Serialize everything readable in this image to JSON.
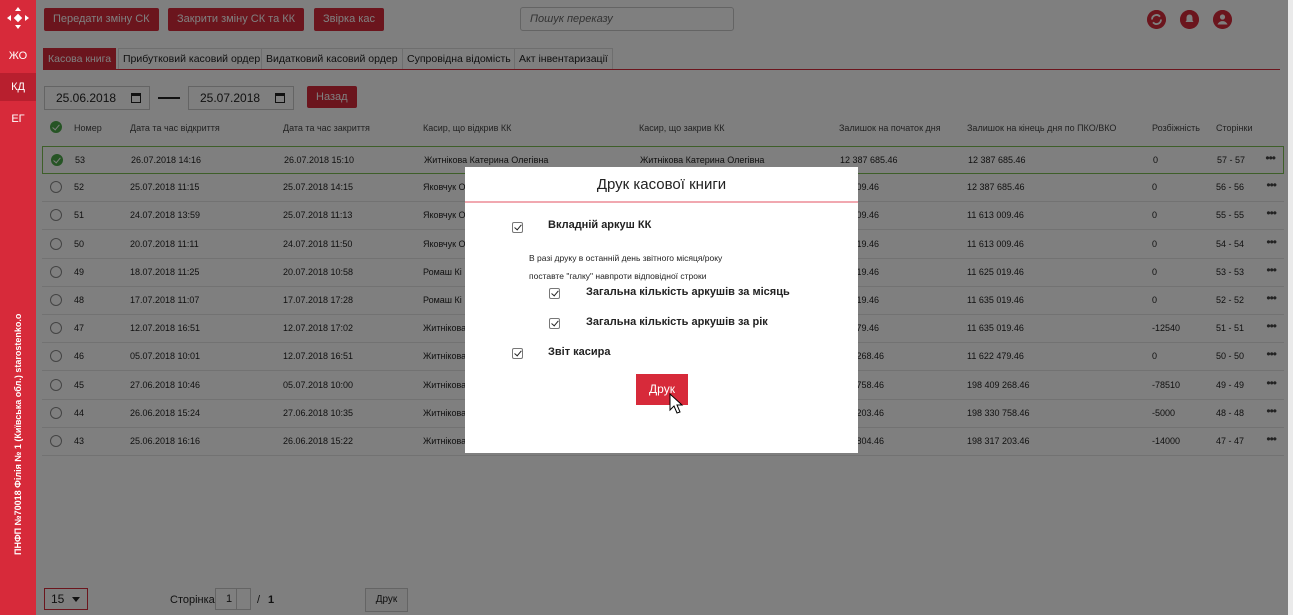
{
  "rail": {
    "items": [
      {
        "label": "ЖО"
      },
      {
        "label": "КД"
      },
      {
        "label": "ЕГ"
      }
    ],
    "vertical_text": "ПНФП №70018 Філія № 1 (Київська обл.) starostenko.o"
  },
  "toolbar": {
    "transfer_shift": "Передати зміну СК",
    "close_shift": "Закрити зміну СК та КК",
    "reconcile": "Звірка кас",
    "search_placeholder": "Пошук переказу"
  },
  "tabs": [
    {
      "label": "Касова книга"
    },
    {
      "label": "Прибутковий касовий ордер"
    },
    {
      "label": "Видатковий касовий ордер"
    },
    {
      "label": "Супровідна відомість"
    },
    {
      "label": "Акт інвентаризації"
    }
  ],
  "filter": {
    "date_from": "25.06.2018",
    "date_to": "25.07.2018",
    "back_label": "Назад"
  },
  "table": {
    "headers": {
      "number": "Номер",
      "opened": "Дата та час відкриття",
      "closed": "Дата та час закриття",
      "cashier_open": "Касир, що відкрив КК",
      "cashier_close": "Касир, що закрив КК",
      "balance_start": "Залишок на початок дня",
      "balance_end": "Залишок на кінець дня по ПКО/ВКО",
      "diff": "Розбіжність",
      "pages": "Сторінки"
    },
    "rows": [
      {
        "number": "53",
        "opened": "26.07.2018 14:16",
        "closed": "26.07.2018 15:10",
        "cashier_open": "Житнікова Катерина Олегівна",
        "cashier_close": "Житнікова Катерина Олегівна",
        "balance_start": "12 387 685.46",
        "balance_end": "12 387 685.46",
        "diff": "0",
        "pages": "57 - 57"
      },
      {
        "number": "52",
        "opened": "25.07.2018 11:15",
        "closed": "25.07.2018 14:15",
        "cashier_open": "Яковчук О",
        "cashier_close": "",
        "balance_start": "13 009.46",
        "balance_end": "12 387 685.46",
        "diff": "0",
        "pages": "56 - 56"
      },
      {
        "number": "51",
        "opened": "24.07.2018 13:59",
        "closed": "25.07.2018 11:13",
        "cashier_open": "Яковчук О",
        "cashier_close": "",
        "balance_start": "13 009.46",
        "balance_end": "11 613 009.46",
        "diff": "0",
        "pages": "55 - 55"
      },
      {
        "number": "50",
        "opened": "20.07.2018 11:11",
        "closed": "24.07.2018 11:50",
        "cashier_open": "Яковчук О",
        "cashier_close": "",
        "balance_start": "25 019.46",
        "balance_end": "11 613 009.46",
        "diff": "0",
        "pages": "54 - 54"
      },
      {
        "number": "49",
        "opened": "18.07.2018 11:25",
        "closed": "20.07.2018 10:58",
        "cashier_open": "Ромаш Кі",
        "cashier_close": "",
        "balance_start": "35 019.46",
        "balance_end": "11 625 019.46",
        "diff": "0",
        "pages": "53 - 53"
      },
      {
        "number": "48",
        "opened": "17.07.2018 11:07",
        "closed": "17.07.2018 17:28",
        "cashier_open": "Ромаш Кі",
        "cashier_close": "",
        "balance_start": "35 019.46",
        "balance_end": "11 635 019.46",
        "diff": "0",
        "pages": "52 - 52"
      },
      {
        "number": "47",
        "opened": "12.07.2018 16:51",
        "closed": "12.07.2018 17:02",
        "cashier_open": "Житнікова",
        "cashier_close": "",
        "balance_start": "22 479.46",
        "balance_end": "11 635 019.46",
        "diff": "-12540",
        "pages": "51 - 51"
      },
      {
        "number": "46",
        "opened": "05.07.2018 10:01",
        "closed": "12.07.2018 16:51",
        "cashier_open": "Житнікова",
        "cashier_close": "",
        "balance_start": "409 268.46",
        "balance_end": "11 622 479.46",
        "diff": "0",
        "pages": "50 - 50"
      },
      {
        "number": "45",
        "opened": "27.06.2018 10:46",
        "closed": "05.07.2018 10:00",
        "cashier_open": "Житнікова",
        "cashier_close": "",
        "balance_start": "330 758.46",
        "balance_end": "198 409 268.46",
        "diff": "-78510",
        "pages": "49 - 49"
      },
      {
        "number": "44",
        "opened": "26.06.2018 15:24",
        "closed": "27.06.2018 10:35",
        "cashier_open": "Житнікова",
        "cashier_close": "",
        "balance_start": "317 203.46",
        "balance_end": "198 330 758.46",
        "diff": "-5000",
        "pages": "48 - 48"
      },
      {
        "number": "43",
        "opened": "25.06.2018 16:16",
        "closed": "26.06.2018 15:22",
        "cashier_open": "Житнікова",
        "cashier_close": "",
        "balance_start": "321 804.46",
        "balance_end": "198 317 203.46",
        "diff": "-14000",
        "pages": "47 - 47"
      }
    ]
  },
  "footer": {
    "page_size": "15",
    "page_label": "Сторінка",
    "page_current": "1",
    "page_sep": "/",
    "page_total": "1",
    "print_label": "Друк"
  },
  "modal": {
    "title": "Друк касової книги",
    "opt_insert_sheet": "Вкладній аркуш КК",
    "note_line1": "В разі друку в останній день звітного місяця/року",
    "note_line2": "поставте \"галку\" навпроти відповідної строки",
    "opt_month_total": "Загальна кількість аркушів за місяць",
    "opt_year_total": "Загальна кількість аркушів за рік",
    "opt_cashier_report": "Звіт касира",
    "print_button": "Друк"
  },
  "colors": {
    "accent": "#d72a3a",
    "selected_row_border": "#7cbf52"
  }
}
